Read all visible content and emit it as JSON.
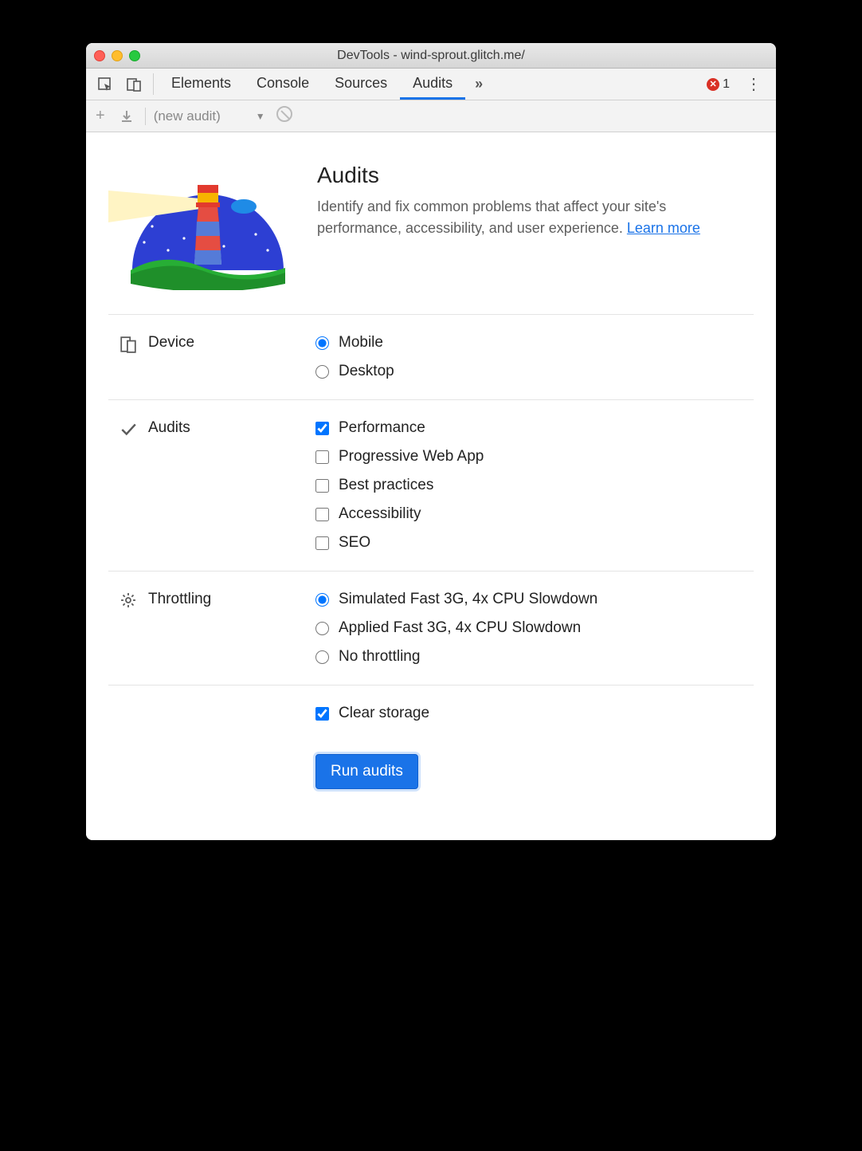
{
  "window": {
    "title": "DevTools - wind-sprout.glitch.me/"
  },
  "tabs": {
    "items": [
      "Elements",
      "Console",
      "Sources",
      "Audits"
    ],
    "active_index": 3,
    "overflow_glyph": "»",
    "error_count": "1"
  },
  "toolbar": {
    "plus": "+",
    "audit_selector": "(new audit)"
  },
  "hero": {
    "heading": "Audits",
    "description_pre": "Identify and fix common problems that affect your site's performance, accessibility, and user experience. ",
    "learn_more": "Learn more"
  },
  "sections": {
    "device": {
      "label": "Device",
      "options": [
        {
          "label": "Mobile",
          "checked": true
        },
        {
          "label": "Desktop",
          "checked": false
        }
      ]
    },
    "audits": {
      "label": "Audits",
      "options": [
        {
          "label": "Performance",
          "checked": true
        },
        {
          "label": "Progressive Web App",
          "checked": false
        },
        {
          "label": "Best practices",
          "checked": false
        },
        {
          "label": "Accessibility",
          "checked": false
        },
        {
          "label": "SEO",
          "checked": false
        }
      ]
    },
    "throttling": {
      "label": "Throttling",
      "options": [
        {
          "label": "Simulated Fast 3G, 4x CPU Slowdown",
          "checked": true
        },
        {
          "label": "Applied Fast 3G, 4x CPU Slowdown",
          "checked": false
        },
        {
          "label": "No throttling",
          "checked": false
        }
      ]
    },
    "clear_storage": {
      "label": "Clear storage",
      "checked": true
    }
  },
  "actions": {
    "run": "Run audits"
  }
}
